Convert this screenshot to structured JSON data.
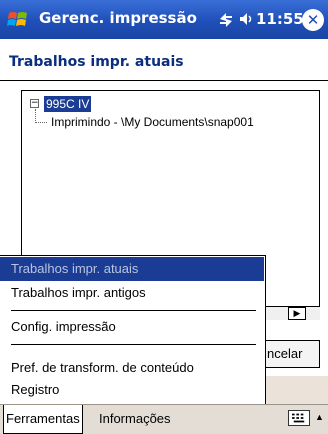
{
  "titlebar": {
    "title": "Gerenc. impressão",
    "clock": "11:55",
    "close": "✕",
    "icons": [
      "windows-logo-icon",
      "connectivity-icon",
      "volume-icon",
      "close-icon"
    ]
  },
  "header": {
    "title": "Trabalhos impr. atuais"
  },
  "tree": {
    "expander": "−",
    "root": "995C IV",
    "child": "Imprimindo - \\My Documents\\snap001"
  },
  "buttons": {
    "cancel": "ncelar"
  },
  "menu": {
    "items": [
      "Trabalhos impr. atuais",
      "Trabalhos impr. antigos",
      "Config. impressão",
      "Pref. de transform. de conteúdo",
      "Registro"
    ]
  },
  "menubar": {
    "tools": "Ferramentas",
    "info": "Informações"
  },
  "colors": {
    "titlebar": "#1f4fb8",
    "selection": "#1a3c94",
    "menubar": "#e3ddd5"
  }
}
